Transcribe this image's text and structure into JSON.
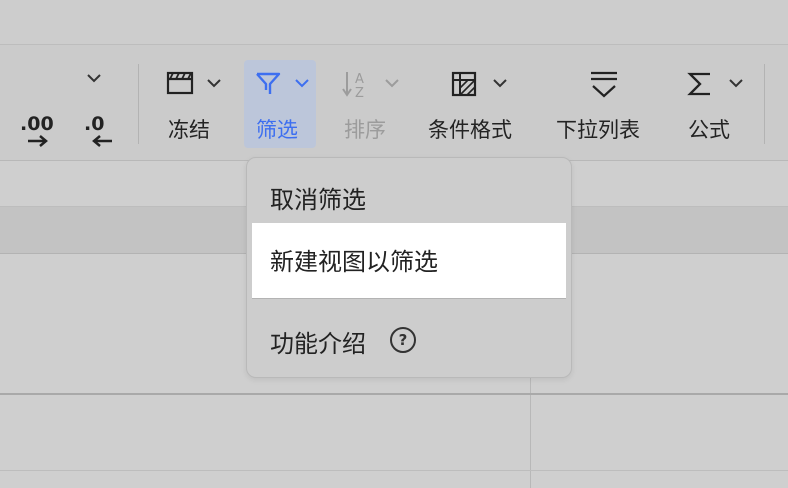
{
  "toolbar": {
    "increase_decimal_label": ".00",
    "decrease_decimal_label": ".0",
    "freeze": {
      "label": "冻结",
      "icon": "freeze-panes-icon"
    },
    "filter": {
      "label": "筛选",
      "icon": "filter-icon",
      "active_color": "#3d6ff0"
    },
    "sort": {
      "label": "排序",
      "icon": "sort-icon",
      "disabled": true
    },
    "conditional_format": {
      "label": "条件格式",
      "icon": "conditional-format-icon"
    },
    "dropdown_list": {
      "label": "下拉列表",
      "icon": "dropdown-list-icon"
    },
    "formula": {
      "label": "公式",
      "icon": "sigma-icon"
    }
  },
  "filter_menu": {
    "items": [
      {
        "label": "取消筛选",
        "highlighted": false
      },
      {
        "label": "新建视图以筛选",
        "highlighted": true
      },
      {
        "label": "功能介绍",
        "icon": "help-circle-icon",
        "icon_glyph": "?"
      }
    ]
  },
  "colors": {
    "accent": "#3d6ff0",
    "toolbar_bg": "#cbcbcb",
    "menu_bg": "#cdcdcd",
    "highlight_bg": "#ffffff"
  }
}
